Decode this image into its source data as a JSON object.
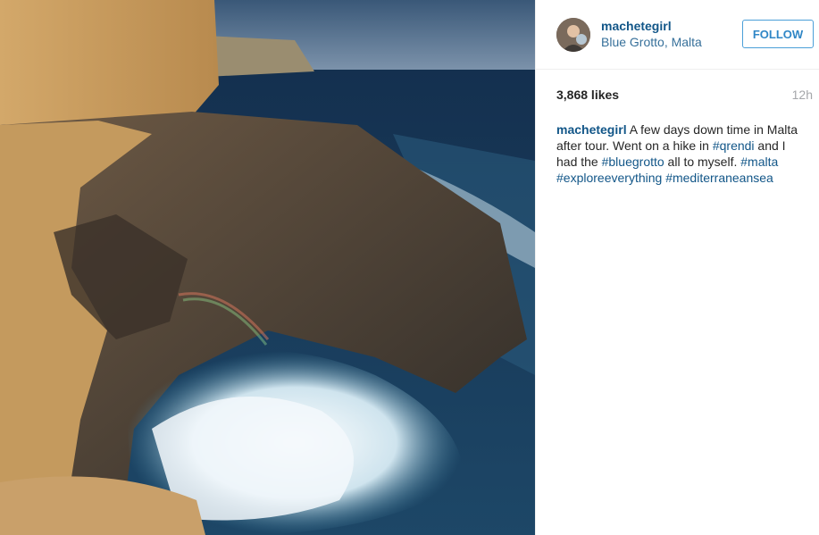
{
  "post": {
    "username": "machetegirl",
    "location": "Blue Grotto, Malta",
    "follow_label": "FOLLOW",
    "likes": "3,868 likes",
    "time": "12h",
    "caption": {
      "username": "machetegirl",
      "t1": " A few days down time in Malta after tour. Went on a hike in ",
      "tag1": "#qrendi",
      "t2": " and I had the ",
      "tag2": "#bluegrotto",
      "t3": " all to myself. ",
      "tag3": "#malta",
      "t4": " ",
      "tag4": "#exploreeverything",
      "t5": " ",
      "tag5": "#mediterraneansea"
    }
  },
  "colors": {
    "link": "#125688",
    "follow": "#3897f0",
    "muted": "#a5a7aa"
  },
  "icons": {
    "photo": "coastal-cliff-photo",
    "avatar": "user-avatar"
  }
}
